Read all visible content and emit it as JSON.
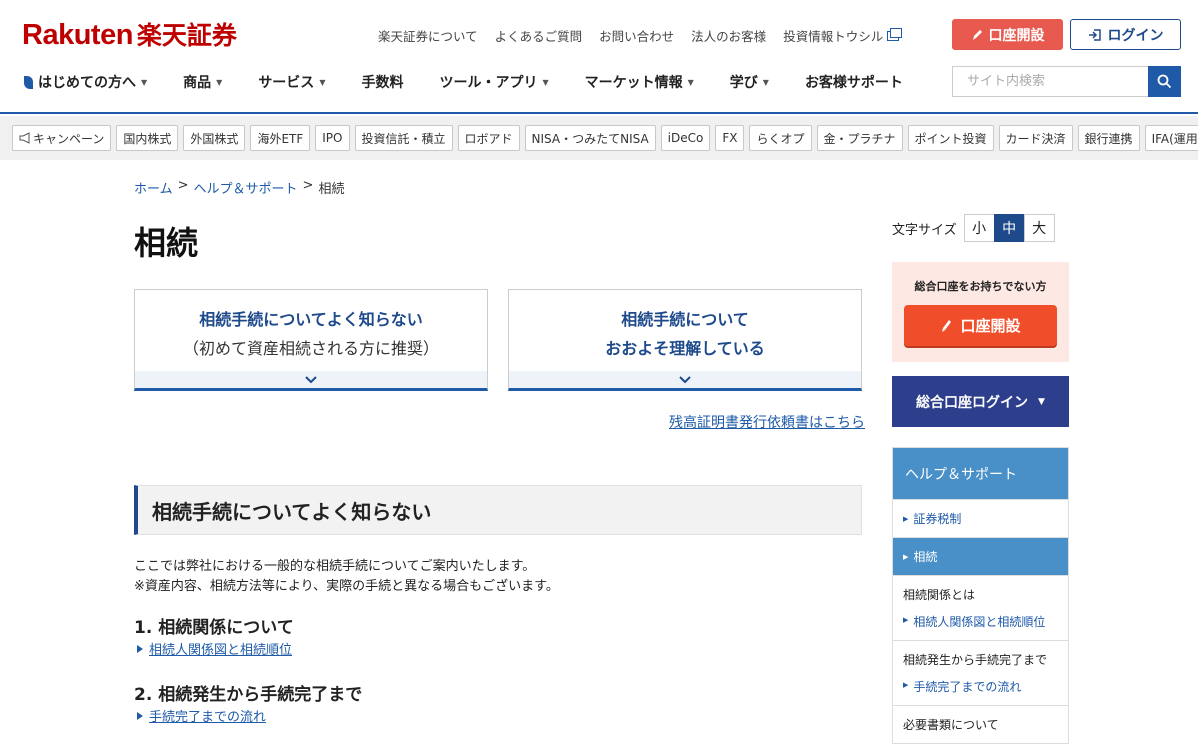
{
  "header": {
    "logo_latin": "Rakuten",
    "logo_jp": "楽天証券",
    "util_links": [
      "楽天証券について",
      "よくあるご質問",
      "お問い合わせ",
      "法人のお客様",
      "投資情報トウシル"
    ],
    "open_account": "口座開設",
    "login": "ログイン",
    "nav": [
      "はじめての方へ",
      "商品",
      "サービス",
      "手数料",
      "ツール・アプリ",
      "マーケット情報",
      "学び",
      "お客様サポート"
    ],
    "search_placeholder": "サイト内検索",
    "colors": {
      "brand": "#bf0000",
      "accent": "#1e5aa8",
      "open_button": "#e85a4f"
    }
  },
  "categories": [
    "キャンペーン",
    "国内株式",
    "外国株式",
    "海外ETF",
    "IPO",
    "投資信託・積立",
    "ロボアド",
    "NISA・つみたてNISA",
    "iDeCo",
    "FX",
    "らくオプ",
    "金・プラチナ",
    "ポイント投資",
    "カード決済",
    "銀行連携",
    "IFA(運用相談)"
  ],
  "breadcrumb": {
    "home": "ホーム",
    "help": "ヘルプ＆サポート",
    "current": "相続",
    "sep": ">"
  },
  "page_title": "相続",
  "cards": {
    "card1_line1": "相続手続についてよく知らない",
    "card1_line2": "（初めて資産相続される方に推奨）",
    "card2_line1": "相続手続について",
    "card2_line2": "おおよそ理解している"
  },
  "balance_link": "残高証明書発行依頼書はこちら",
  "section": {
    "heading": "相続手続についてよく知らない",
    "intro_line1": "ここでは弊社における一般的な相続手続についてご案内いたします。",
    "intro_line2": "※資産内容、相続方法等により、実際の手続と異なる場合もございます。",
    "sub1_title": "1. 相続関係について",
    "sub1_link": "相続人関係図と相続順位",
    "sub2_title": "2. 相続発生から手続完了まで",
    "sub2_link": "手続完了までの流れ"
  },
  "sidebar": {
    "font_size_label": "文字サイズ",
    "font_sizes": [
      "小",
      "中",
      "大"
    ],
    "promo_text": "総合口座をお持ちでない方",
    "promo_button": "口座開設",
    "login_button": "総合口座ログイン",
    "nav_head": "ヘルプ＆サポート",
    "nav_item_tax": "証券税制",
    "nav_item_inherit": "相続",
    "group1_title": "相続関係とは",
    "group1_link": "相続人関係図と相続順位",
    "group2_title": "相続発生から手続完了まで",
    "group2_link": "手続完了までの流れ",
    "group3_title": "必要書類について"
  }
}
